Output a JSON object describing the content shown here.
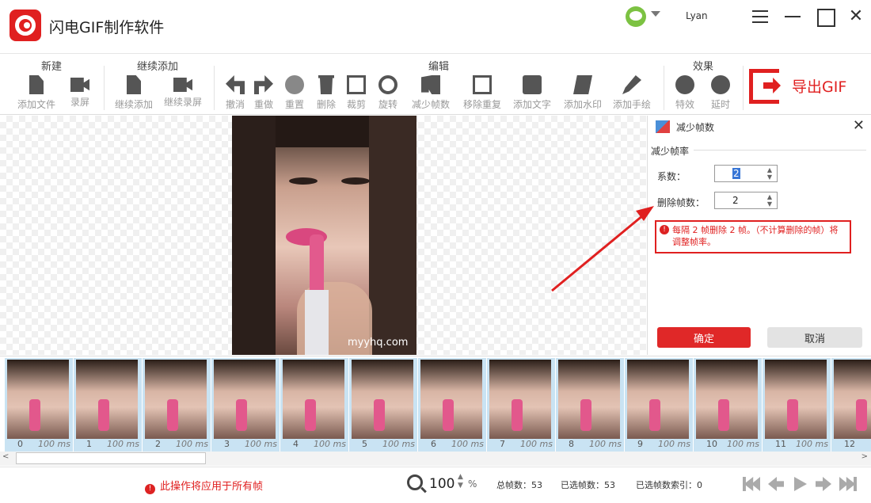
{
  "app": {
    "title": "闪电GIF制作软件",
    "user": "Lyan"
  },
  "toolbar": {
    "groups": [
      {
        "label": "新建"
      },
      {
        "label": "继续添加"
      },
      {
        "label": "编辑"
      },
      {
        "label": "效果"
      }
    ],
    "tools": [
      {
        "label": "添加文件",
        "icon": "add-file-icon"
      },
      {
        "label": "录屏",
        "icon": "record-screen-icon"
      },
      {
        "label": "继续添加",
        "icon": "continue-add-icon"
      },
      {
        "label": "继续录屏",
        "icon": "continue-record-icon"
      },
      {
        "label": "撤消",
        "icon": "undo-icon"
      },
      {
        "label": "重做",
        "icon": "redo-icon"
      },
      {
        "label": "重置",
        "icon": "reset-icon"
      },
      {
        "label": "删除",
        "icon": "delete-icon"
      },
      {
        "label": "裁剪",
        "icon": "crop-icon"
      },
      {
        "label": "旋转",
        "icon": "rotate-icon"
      },
      {
        "label": "减少帧数",
        "icon": "reduce-frames-icon"
      },
      {
        "label": "移除重复",
        "icon": "remove-duplicates-icon"
      },
      {
        "label": "添加文字",
        "icon": "add-text-icon"
      },
      {
        "label": "添加水印",
        "icon": "add-watermark-icon"
      },
      {
        "label": "添加手绘",
        "icon": "add-drawing-icon"
      },
      {
        "label": "特效",
        "icon": "effects-icon"
      },
      {
        "label": "延时",
        "icon": "delay-icon"
      }
    ],
    "export_label": "导出GIF"
  },
  "canvas": {
    "watermark": "myyhq.com"
  },
  "panel": {
    "title": "减少帧数",
    "section": "减少帧率",
    "coef_label": "系数：",
    "coef_value": "2",
    "delete_label": "删除帧数：",
    "delete_value": "2",
    "note": "每隔 2 帧删除 2 帧。（不计算删除的帧）将调整帧率。",
    "ok_label": "确定",
    "cancel_label": "取消"
  },
  "frames": [
    {
      "index": "0",
      "duration": "100 ms"
    },
    {
      "index": "1",
      "duration": "100 ms"
    },
    {
      "index": "2",
      "duration": "100 ms"
    },
    {
      "index": "3",
      "duration": "100 ms"
    },
    {
      "index": "4",
      "duration": "100 ms"
    },
    {
      "index": "5",
      "duration": "100 ms"
    },
    {
      "index": "6",
      "duration": "100 ms"
    },
    {
      "index": "7",
      "duration": "100 ms"
    },
    {
      "index": "8",
      "duration": "100 ms"
    },
    {
      "index": "9",
      "duration": "100 ms"
    },
    {
      "index": "10",
      "duration": "100 ms"
    },
    {
      "index": "11",
      "duration": "100 ms"
    },
    {
      "index": "12",
      "duration": ""
    }
  ],
  "status": {
    "warning": "此操作将应用于所有帧",
    "zoom": "100",
    "zoom_unit": "%",
    "total_frames": "总帧数：53",
    "selected_frames": "已选帧数：53",
    "selected_index": "已选帧数索引：0"
  },
  "colors": {
    "accent": "#e02020",
    "frame_bg": "#c9e3f3"
  }
}
